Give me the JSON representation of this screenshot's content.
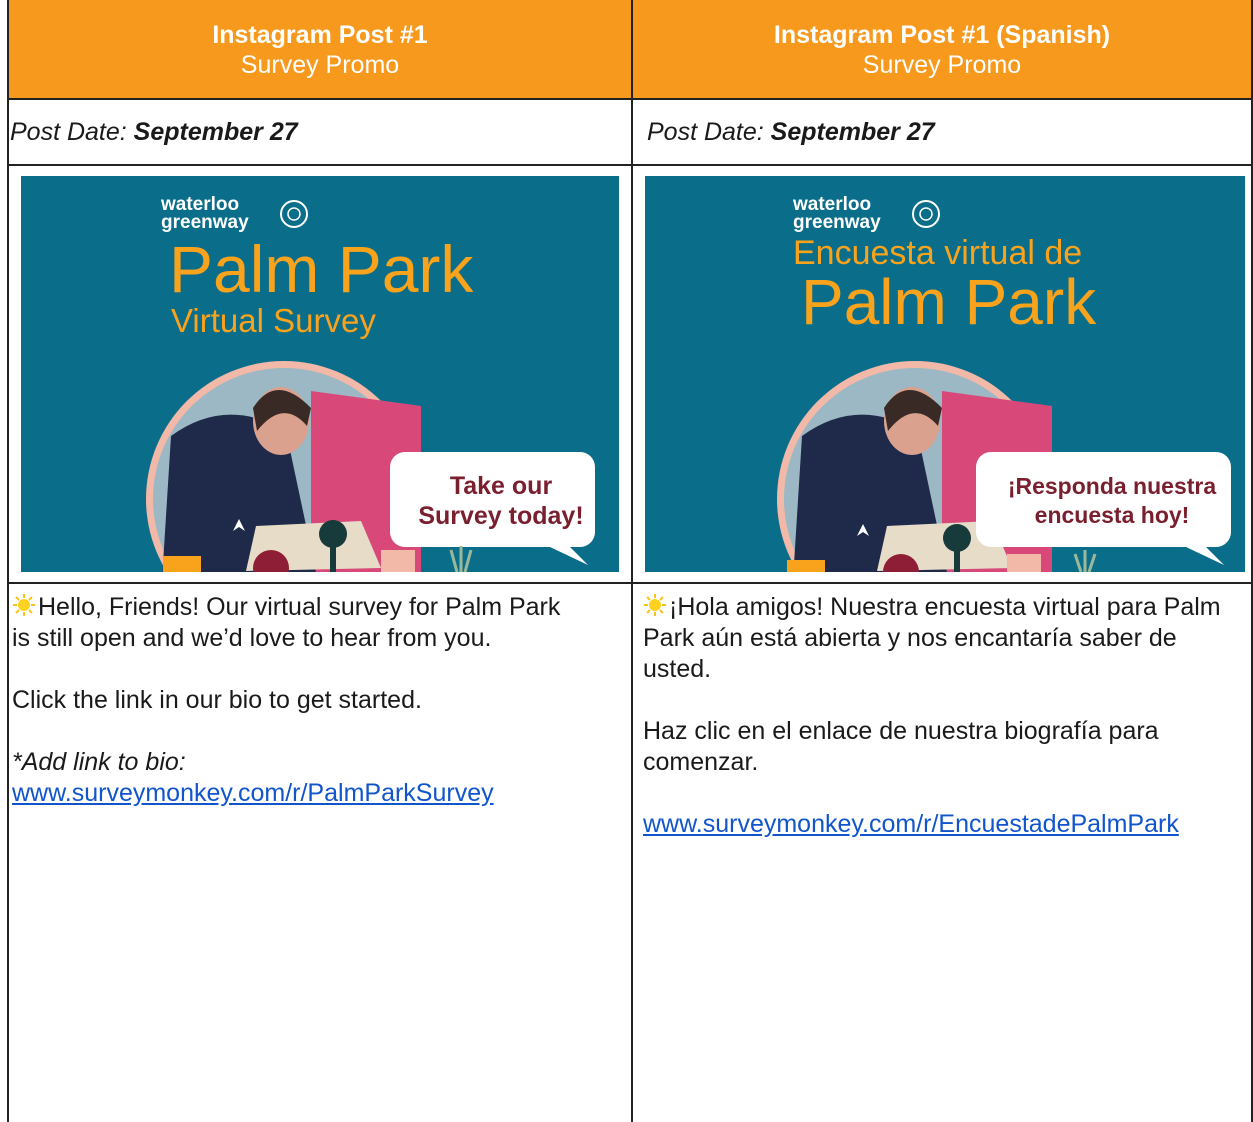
{
  "columns": [
    {
      "title": "Instagram Post #1",
      "subtitle": "Survey Promo",
      "date_label": "Post Date: ",
      "date_value": "September 27",
      "image": {
        "brand_line1": "waterloo",
        "brand_line2": "greenway",
        "headline_small": "",
        "headline_big": "Palm Park",
        "headline_sub": "Virtual Survey",
        "bubble_line1": "Take our",
        "bubble_line2": "Survey today!"
      },
      "paragraph1": "Hello, Friends! Our virtual survey for Palm Park is still open and we’d love to hear from you.",
      "paragraph2": "Click the link in our bio to get started.",
      "note": "*Add link to bio:",
      "link": "www.surveymonkey.com/r/PalmParkSurvey"
    },
    {
      "title": "Instagram Post #1 (Spanish)",
      "subtitle": "Survey Promo",
      "date_label": "Post Date: ",
      "date_value": "September 27",
      "image": {
        "brand_line1": "waterloo",
        "brand_line2": "greenway",
        "headline_small": "Encuesta virtual de",
        "headline_big": "Palm Park",
        "headline_sub": "",
        "bubble_line1": "¡Responda nuestra",
        "bubble_line2": "encuesta hoy!"
      },
      "paragraph1": "¡Hola amigos! Nuestra encuesta virtual para Palm Park aún está abierta y nos encantaría saber de usted.",
      "paragraph2": "Haz clic en el enlace de nuestra biografía para comenzar.",
      "note": "",
      "link": "www.surveymonkey.com/r/EncuestadePalmPark"
    }
  ],
  "colors": {
    "header": "#F7991C",
    "post_bg": "#0A6E8A",
    "headline": "#F9A21B",
    "bubble_text": "#7A1F2E",
    "link": "#1155CC"
  },
  "icons": [
    "sun-emoji-icon",
    "city-seal-icon"
  ]
}
